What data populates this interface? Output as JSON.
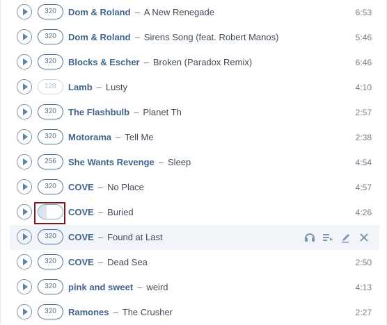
{
  "tracks": [
    {
      "bitrate": "320",
      "artist": "Dom & Roland",
      "title": "A New Renegade",
      "duration": "6:53",
      "bitrate_style": "normal"
    },
    {
      "bitrate": "320",
      "artist": "Dom & Roland",
      "title": "Sirens Song (feat. Robert Manos)",
      "duration": "5:46",
      "bitrate_style": "normal"
    },
    {
      "bitrate": "320",
      "artist": "Blocks & Escher",
      "title": "Broken (Paradox Remix)",
      "duration": "6:46",
      "bitrate_style": "normal"
    },
    {
      "bitrate": "128",
      "artist": "Lamb",
      "title": "Lusty",
      "duration": "4:10",
      "bitrate_style": "low"
    },
    {
      "bitrate": "320",
      "artist": "The Flashbulb",
      "title": "Planet Th",
      "duration": "2:57",
      "bitrate_style": "normal"
    },
    {
      "bitrate": "320",
      "artist": "Motorama",
      "title": "Tell Me",
      "duration": "2:38",
      "bitrate_style": "normal"
    },
    {
      "bitrate": "256",
      "artist": "She Wants Revenge",
      "title": "Sleep",
      "duration": "4:54",
      "bitrate_style": "normal"
    },
    {
      "bitrate": "320",
      "artist": "COVE",
      "title": "No Place",
      "duration": "4:57",
      "bitrate_style": "normal"
    },
    {
      "bitrate": "",
      "artist": "COVE",
      "title": "Buried",
      "duration": "4:26",
      "bitrate_style": "loading",
      "selected": true
    },
    {
      "bitrate": "320",
      "artist": "COVE",
      "title": "Found at Last",
      "duration": "",
      "bitrate_style": "normal",
      "hover": true,
      "actions": [
        "headphones-icon",
        "add-to-playlist-icon",
        "edit-icon",
        "close-icon"
      ]
    },
    {
      "bitrate": "320",
      "artist": "COVE",
      "title": "Dead Sea",
      "duration": "2:50",
      "bitrate_style": "normal"
    },
    {
      "bitrate": "320",
      "artist": "pink and sweet",
      "title": "weird",
      "duration": "4:13",
      "bitrate_style": "normal"
    },
    {
      "bitrate": "320",
      "artist": "Ramones",
      "title": "The Crusher",
      "duration": "2:27",
      "bitrate_style": "normal"
    }
  ],
  "separator": "–",
  "colors": {
    "artist": "#42648c",
    "title": "#3f4a57",
    "play": "#5f7fa3",
    "selection_outline": "#7b1820",
    "hover_row": "#f1f4f8"
  }
}
